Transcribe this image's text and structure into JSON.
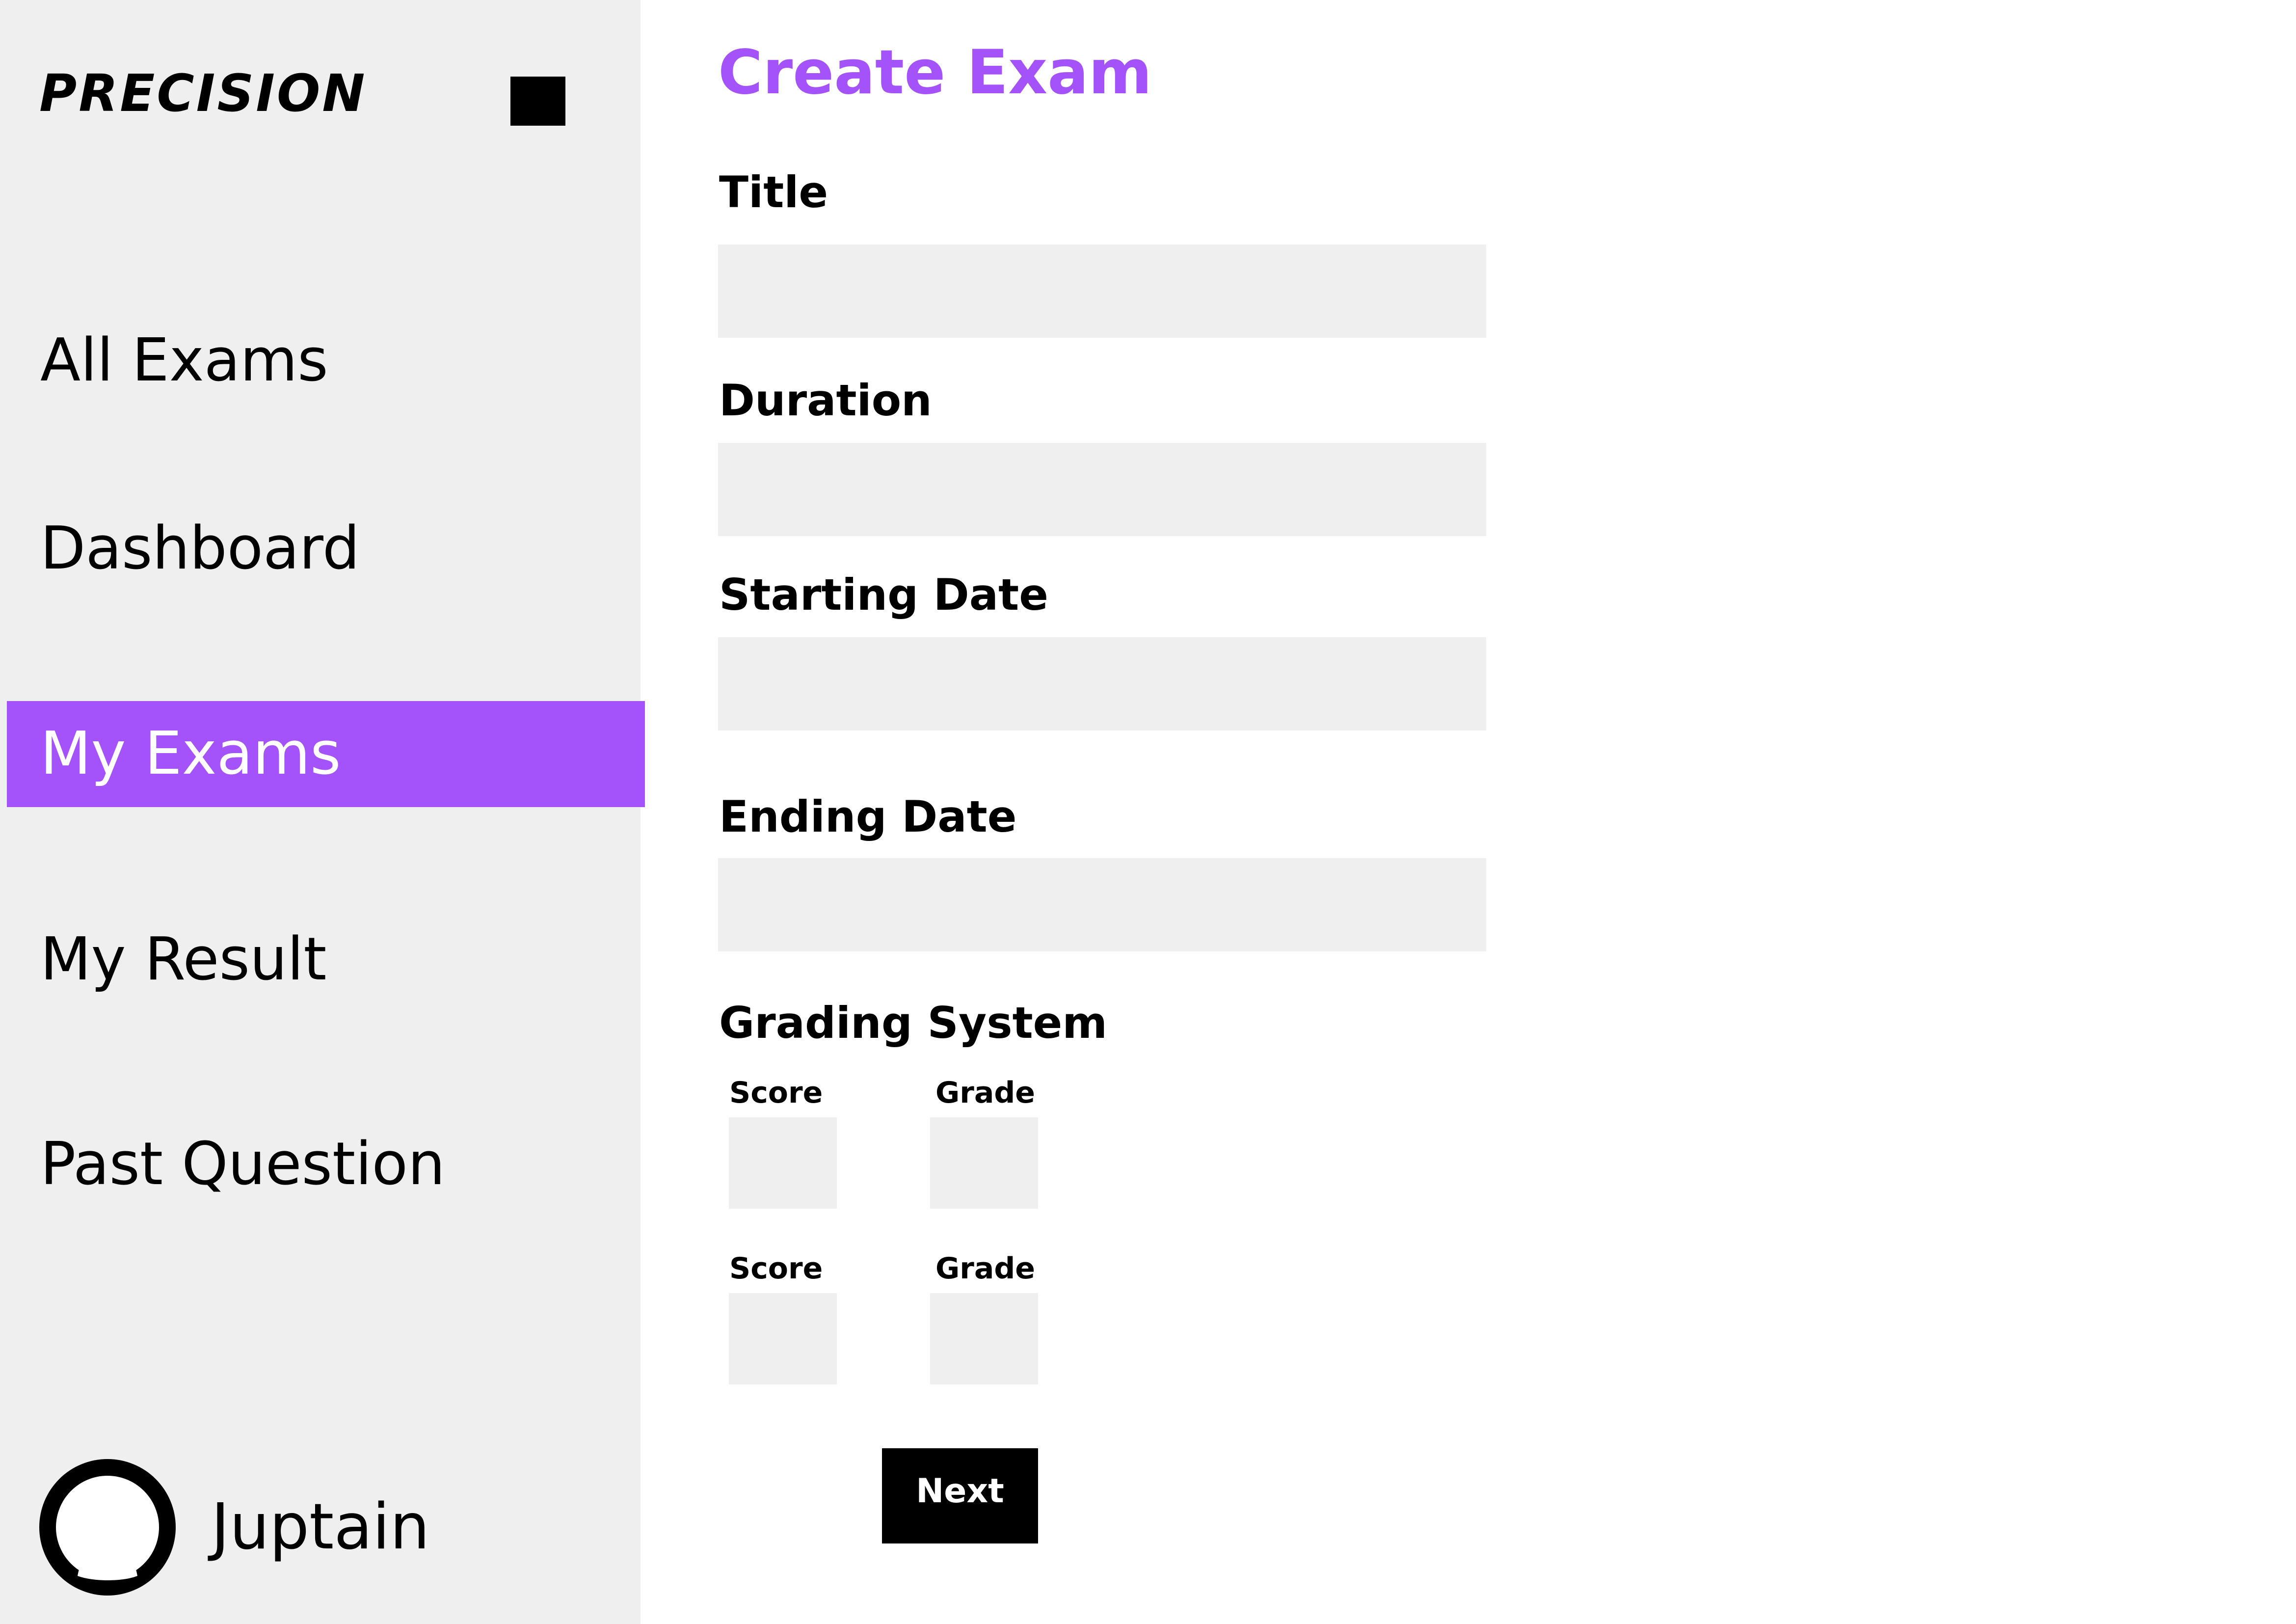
{
  "app": {
    "logo_text": "PRECISION"
  },
  "theme": {
    "accent": "#a452fa",
    "sidebar_bg": "#efefef",
    "input_bg": "#efefef",
    "button_bg": "#000000"
  },
  "sidebar": {
    "items": [
      {
        "label": "All Exams",
        "active": false
      },
      {
        "label": "Dashboard",
        "active": false
      },
      {
        "label": "My Exams",
        "active": true
      },
      {
        "label": "My Result",
        "active": false
      },
      {
        "label": "Past Question",
        "active": false
      }
    ],
    "user": {
      "name": "Juptain",
      "avatar_icon": "user-icon"
    },
    "menu_icon": "menu-toggle-icon"
  },
  "form": {
    "title": "Create Exam",
    "fields": [
      {
        "label": "Title",
        "value": "",
        "placeholder": ""
      },
      {
        "label": "Duration",
        "value": "",
        "placeholder": ""
      },
      {
        "label": "Starting Date",
        "value": "",
        "placeholder": ""
      },
      {
        "label": "Ending Date",
        "value": "",
        "placeholder": ""
      }
    ],
    "grading": {
      "label": "Grading System",
      "rows": [
        {
          "score_label": "Score",
          "grade_label": "Grade",
          "score_value": "",
          "grade_value": ""
        },
        {
          "score_label": "Score",
          "grade_label": "Grade",
          "score_value": "",
          "grade_value": ""
        }
      ]
    },
    "next_label": "Next"
  }
}
